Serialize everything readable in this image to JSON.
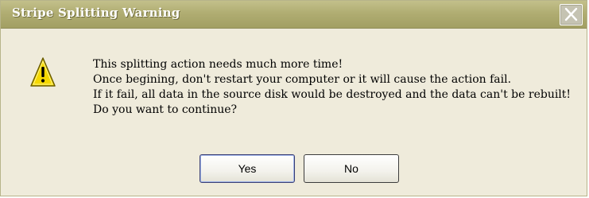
{
  "dialog": {
    "title": "Stripe Splitting Warning",
    "message_lines": [
      "This splitting action needs much more time!",
      "Once begining, don't restart your computer or it will cause the action fail.",
      "If it fail, all data in the source disk would be destroyed and the data can't be rebuilt!",
      "Do you want to continue?"
    ],
    "buttons": {
      "yes_label": "Yes",
      "no_label": "No"
    },
    "icons": {
      "close": "close-icon",
      "warning": "warning-icon"
    }
  },
  "colors": {
    "titlebar": "#b0ad72",
    "dialog_background": "#efebdb",
    "warning_yellow": "#f5d800"
  }
}
